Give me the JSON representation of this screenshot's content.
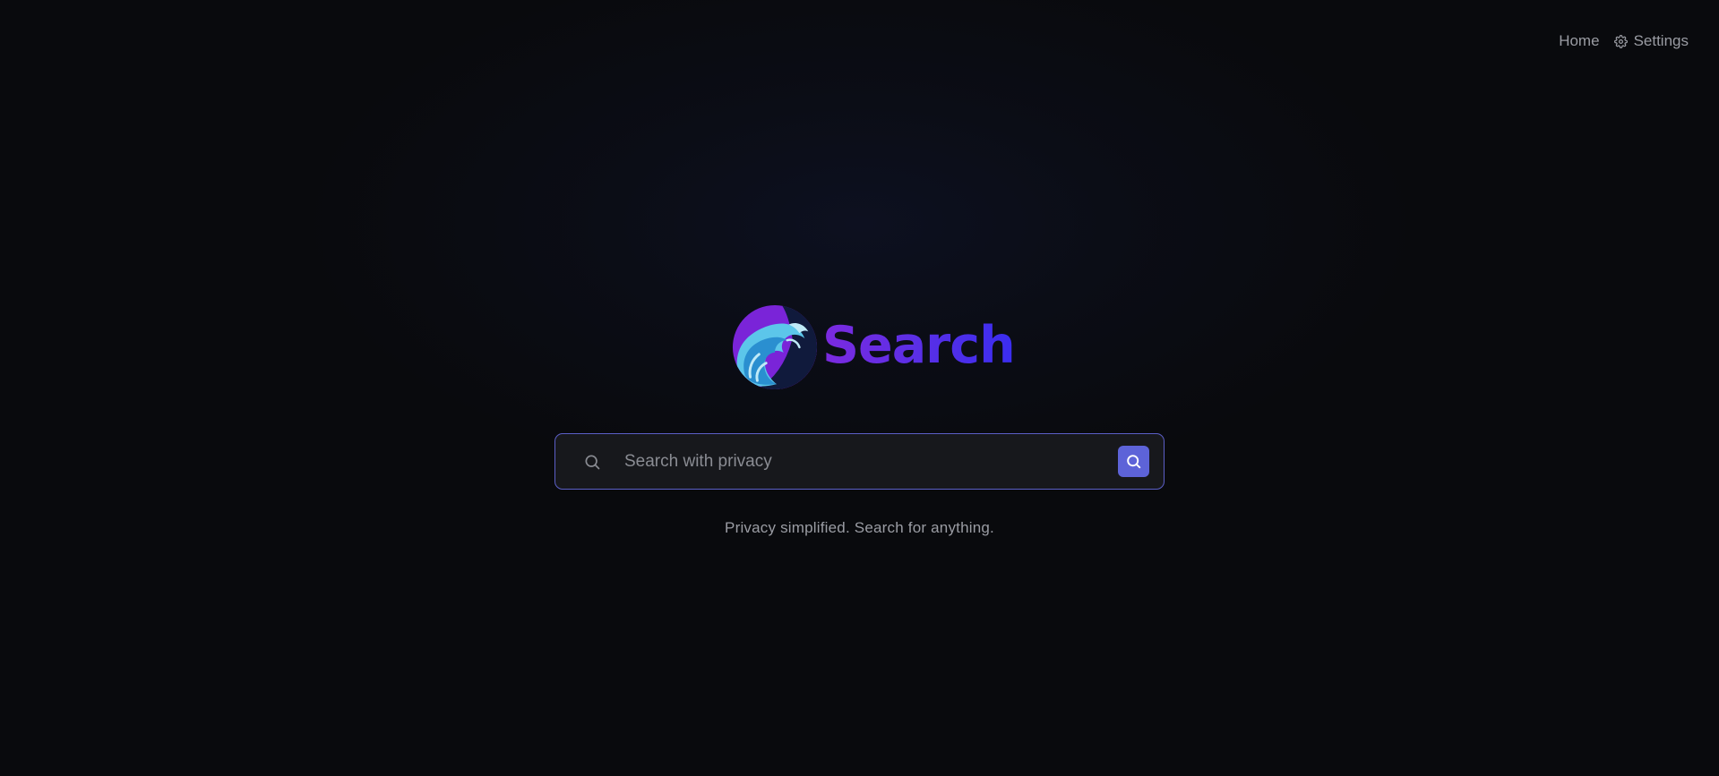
{
  "nav": {
    "home_label": "Home",
    "settings_label": "Settings",
    "settings_icon": "gear-icon"
  },
  "brand": {
    "logo": "wave-logo",
    "name": "Search"
  },
  "search": {
    "placeholder": "Search with privacy",
    "value": "",
    "lead_icon": "search-icon",
    "submit_icon": "search-icon"
  },
  "tagline": "Privacy simplified. Search for anything.",
  "colors": {
    "background": "#090a0d",
    "accent": "#5d63d8",
    "brand_gradient_start": "#7c2ae0",
    "brand_gradient_end": "#3a2df0",
    "muted_text": "#9a9ca3"
  }
}
